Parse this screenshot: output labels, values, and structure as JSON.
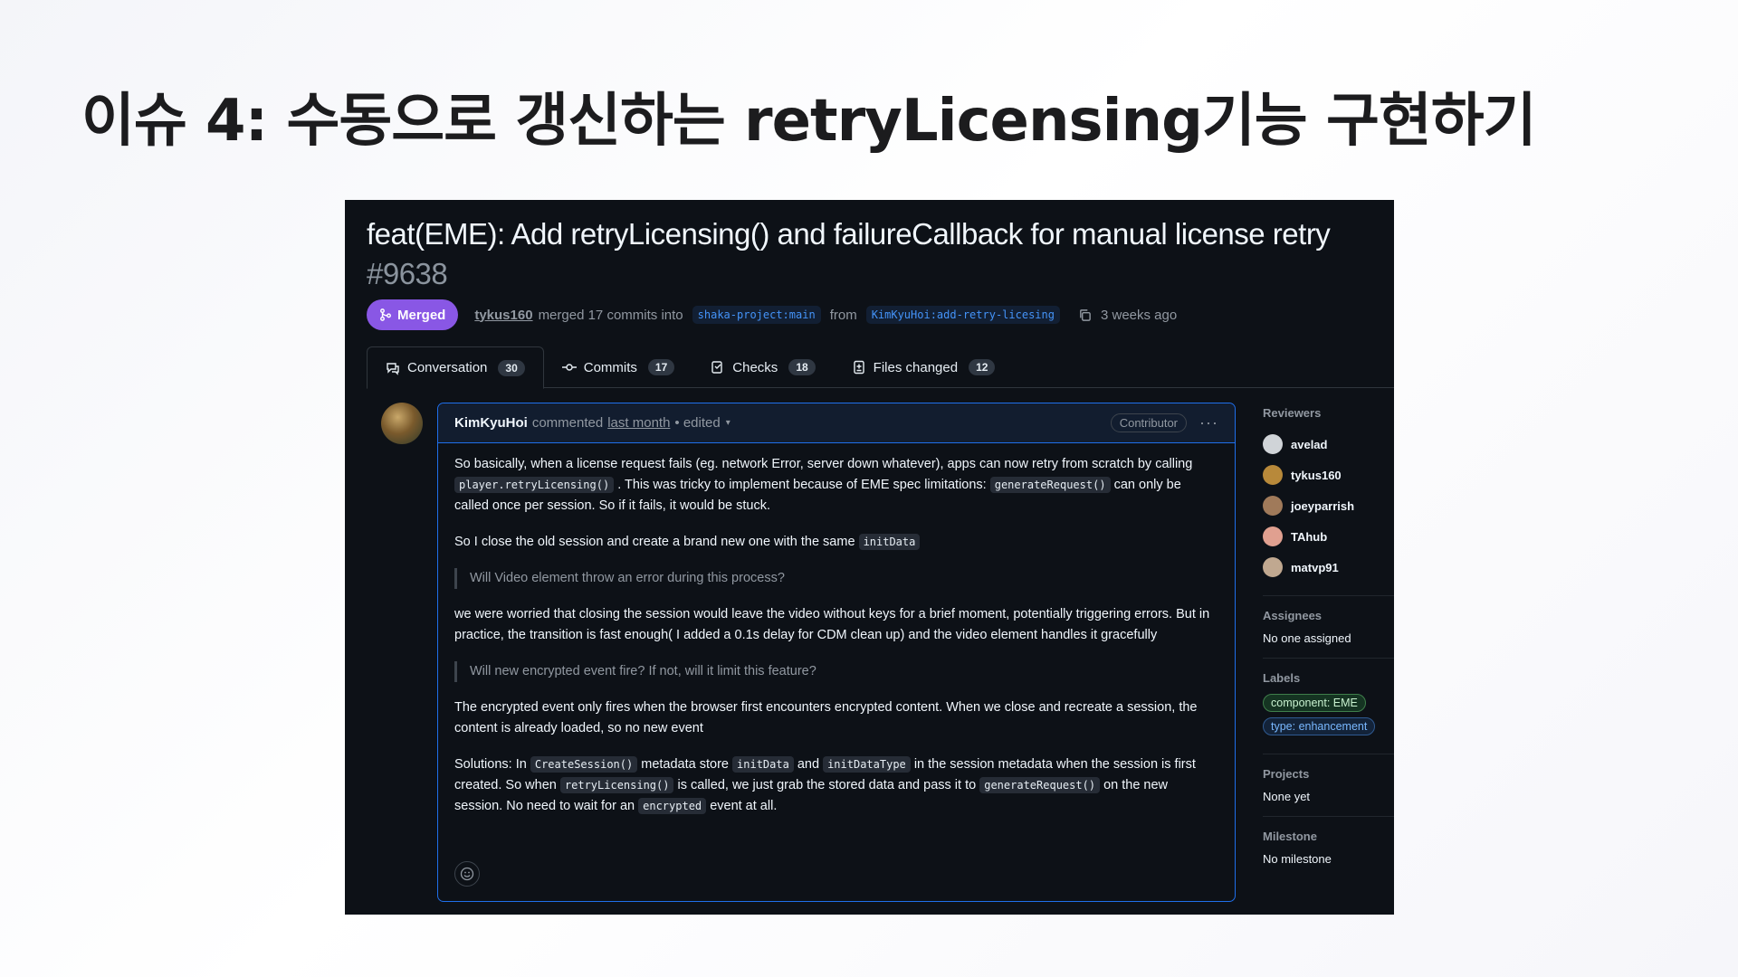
{
  "slide": {
    "title": "이슈 4: 수동으로 갱신하는 retryLicensing기능 구현하기"
  },
  "pr": {
    "title": "feat(EME): Add retryLicensing() and failureCallback for manual license retry",
    "number": "#9638",
    "status": "Merged",
    "author": "tykus160",
    "merge_text": "merged 17 commits into",
    "base_branch": "shaka-project:main",
    "from_text": "from",
    "head_branch": "KimKyuHoi:add-retry-licesing",
    "time": "3 weeks ago"
  },
  "tabs": [
    {
      "label": "Conversation",
      "count": "30",
      "icon": "comment-icon"
    },
    {
      "label": "Commits",
      "count": "17",
      "icon": "commit-icon"
    },
    {
      "label": "Checks",
      "count": "18",
      "icon": "checklist-icon"
    },
    {
      "label": "Files changed",
      "count": "12",
      "icon": "file-diff-icon"
    }
  ],
  "comment": {
    "author": "KimKyuHoi",
    "action": "commented",
    "when": "last month",
    "edited": "• edited",
    "role": "Contributor",
    "p1_a": "So basically, when a license request fails (eg. network Error, server down whatever), apps can now retry from scratch by calling",
    "p1_code1": "player.retryLicensing()",
    "p1_b": ". This was tricky to implement because of EME spec limitations:",
    "p1_code2": "generateRequest()",
    "p1_c": "can only be called once per session. So if it fails, it would be stuck.",
    "p2_a": "So I close the old session and create a brand new one with the same",
    "p2_code": "initData",
    "q1": "Will Video element throw an error during this process?",
    "p3": "we were worried that closing the session would leave the video without keys for a brief moment, potentially triggering errors. But in practice, the transition is fast enough( I added a 0.1s delay for CDM clean up) and the video element handles it gracefully",
    "q2": "Will new encrypted event fire? If not, will it limit this feature?",
    "p4": "The encrypted event only fires when the browser first encounters encrypted content. When we close and recreate a session, the content is already loaded, so no new event",
    "p5_a": "Solutions: In",
    "p5_code1": "CreateSession()",
    "p5_b": "metadata store",
    "p5_code2": "initData",
    "p5_c": "and",
    "p5_code3": "initDataType",
    "p5_d": "in the session metadata when the session is first created. So when",
    "p5_code4": "retryLicensing()",
    "p5_e": "is called, we just grab the stored data and pass it to",
    "p5_code5": "generateRequest()",
    "p5_f": "on the new session. No need to wait for an",
    "p5_code6": "encrypted",
    "p5_g": "event at all."
  },
  "sidebar": {
    "reviewers_heading": "Reviewers",
    "reviewers": [
      "avelad",
      "tykus160",
      "joeyparrish",
      "TAhub",
      "matvp91"
    ],
    "assignees_heading": "Assignees",
    "assignees_value": "No one assigned",
    "labels_heading": "Labels",
    "labels": [
      "component: EME",
      "type: enhancement"
    ],
    "projects_heading": "Projects",
    "projects_value": "None yet",
    "milestone_heading": "Milestone",
    "milestone_value": "No milestone"
  },
  "colors": {
    "merged": "#8957e5",
    "link": "#4493f8",
    "background": "#0d1117",
    "border_active": "#1f6feb"
  }
}
